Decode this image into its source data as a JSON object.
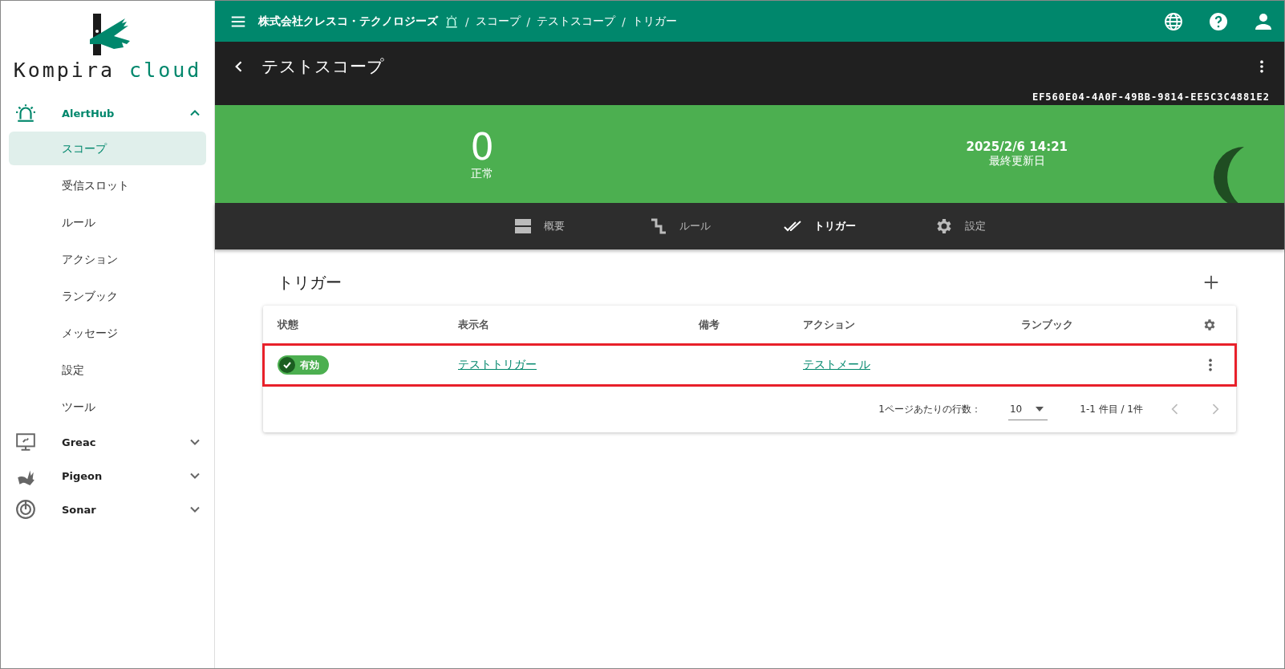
{
  "logo": {
    "word1": "Kompira",
    "word2": "cloud"
  },
  "sidebar": {
    "items": [
      {
        "kind": "alert",
        "label": "AlertHub",
        "expanded": true,
        "children": [
          {
            "label": "スコープ",
            "selected": true
          },
          {
            "label": "受信スロット",
            "selected": false
          },
          {
            "label": "ルール",
            "selected": false
          },
          {
            "label": "アクション",
            "selected": false
          },
          {
            "label": "ランブック",
            "selected": false
          },
          {
            "label": "メッセージ",
            "selected": false
          },
          {
            "label": "設定",
            "selected": false
          },
          {
            "label": "ツール",
            "selected": false
          }
        ]
      },
      {
        "kind": "monitor",
        "label": "Greac",
        "expanded": false
      },
      {
        "kind": "pigeon",
        "label": "Pigeon",
        "expanded": false
      },
      {
        "kind": "sonar",
        "label": "Sonar",
        "expanded": false
      }
    ]
  },
  "topbar": {
    "organization": "株式会社クレスコ・テクノロジーズ",
    "breadcrumb": [
      "スコープ",
      "テストスコープ",
      "トリガー"
    ],
    "separator": "/"
  },
  "header": {
    "title": "テストスコープ",
    "id": "EF560E04-4A0F-49BB-9814-EE5C3C4881E2"
  },
  "summary": {
    "count": "0",
    "status": "正常",
    "updated": "2025/2/6 14:21",
    "updated_label": "最終更新日"
  },
  "tabs": [
    {
      "kind": "overview",
      "label": "概要",
      "selected": false
    },
    {
      "kind": "rule",
      "label": "ルール",
      "selected": false
    },
    {
      "kind": "trigger",
      "label": "トリガー",
      "selected": true
    },
    {
      "kind": "settings",
      "label": "設定",
      "selected": false
    }
  ],
  "section": {
    "title": "トリガー"
  },
  "table": {
    "columns": [
      "状態",
      "表示名",
      "備考",
      "アクション",
      "ランブック"
    ],
    "rows": [
      {
        "status": {
          "label": "有効",
          "on": true
        },
        "name": "テストトリガー",
        "note": "",
        "action": "テストメール",
        "runbook": "",
        "highlighted": true
      }
    ]
  },
  "pagination": {
    "rows_label": "1ページあたりの行数：",
    "rows_value": "10",
    "range": "1-1 件目 / 1件"
  }
}
